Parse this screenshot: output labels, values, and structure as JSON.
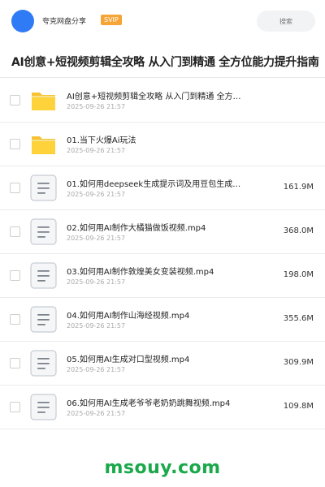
{
  "header": {
    "username": "夸克网盘分享",
    "badge": "SVIP",
    "search_placeholder": "搜索",
    "avatar_color": "#2f7bf5",
    "badge_color": "#f7a436"
  },
  "title": "AI创意+短视频剪辑全攻略 从入门到精通 全方位能力提升指南",
  "items": [
    {
      "type": "folder",
      "name": "AI创意+短视频剪辑全攻略 从入门到精通 全方…",
      "date": "2025-09-26 21:57",
      "size": ""
    },
    {
      "type": "folder",
      "name": "01.当下火爆Ai玩法",
      "date": "2025-09-26 21:57",
      "size": ""
    },
    {
      "type": "file",
      "name": "01.如何用deepseek生成提示词及用豆包生成…",
      "date": "2025-09-26 21:57",
      "size": "161.9M"
    },
    {
      "type": "file",
      "name": "02.如何用AI制作大橘猫做饭视频.mp4",
      "date": "2025-09-26 21:57",
      "size": "368.0M"
    },
    {
      "type": "file",
      "name": "03.如何用AI制作敦煌美女变装视频.mp4",
      "date": "2025-09-26 21:57",
      "size": "198.0M"
    },
    {
      "type": "file",
      "name": "04.如何用AI制作山海经视频.mp4",
      "date": "2025-09-26 21:57",
      "size": "355.6M"
    },
    {
      "type": "file",
      "name": "05.如何用AI生成对口型视频.mp4",
      "date": "2025-09-26 21:57",
      "size": "309.9M"
    },
    {
      "type": "file",
      "name": "06.如何用AI生成老爷爷老奶奶跳舞视频.mp4",
      "date": "2025-09-26 21:57",
      "size": "109.8M"
    }
  ],
  "watermark": "msouy.com",
  "watermark_color": "#1aa84a"
}
